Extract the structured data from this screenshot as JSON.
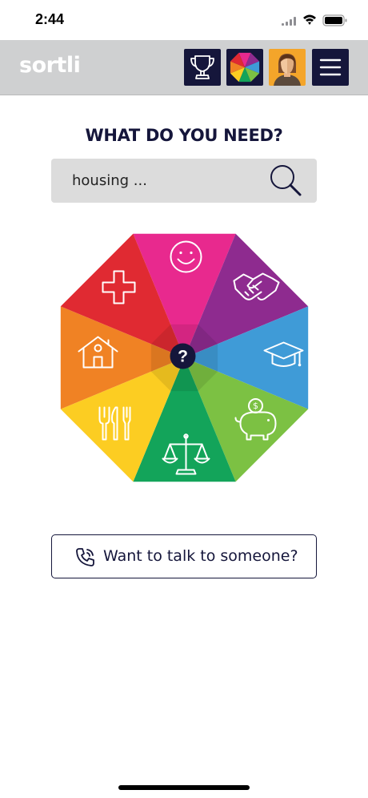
{
  "status_bar": {
    "time": "2:44",
    "icons": [
      "cellular-signal-icon",
      "wifi-icon",
      "battery-icon"
    ]
  },
  "header": {
    "logo": "sortli",
    "background": "#cfd0d1",
    "buttons": [
      {
        "icon": "trophy-icon",
        "background": "#15163b"
      },
      {
        "icon": "color-wheel-icon",
        "background": "#15163b"
      },
      {
        "icon": "avatar-icon",
        "background": "#f4a52a"
      },
      {
        "icon": "hamburger-menu-icon",
        "background": "#15163b"
      }
    ]
  },
  "main": {
    "heading": "WHAT DO YOU NEED?",
    "search": {
      "placeholder": "housing ...",
      "value": "",
      "icon": "search-icon"
    },
    "wheel": {
      "center_label": "?",
      "segments": [
        {
          "icon": "smiley-icon",
          "color": "#e8298e"
        },
        {
          "icon": "handshake-icon",
          "color": "#8e2b8f"
        },
        {
          "icon": "graduation-cap-icon",
          "color": "#3f9bd7"
        },
        {
          "icon": "piggy-bank-icon",
          "color": "#7cc143"
        },
        {
          "icon": "scales-icon",
          "color": "#13a45a"
        },
        {
          "icon": "cutlery-icon",
          "color": "#fccd22"
        },
        {
          "icon": "house-icon",
          "color": "#f08224"
        },
        {
          "icon": "medical-cross-icon",
          "color": "#e02a32"
        }
      ]
    },
    "talk_button": {
      "label": "Want to talk to someone?",
      "icon": "phone-call-icon"
    }
  },
  "colors": {
    "navy": "#15163b",
    "search_bg": "#dcdcdc"
  }
}
